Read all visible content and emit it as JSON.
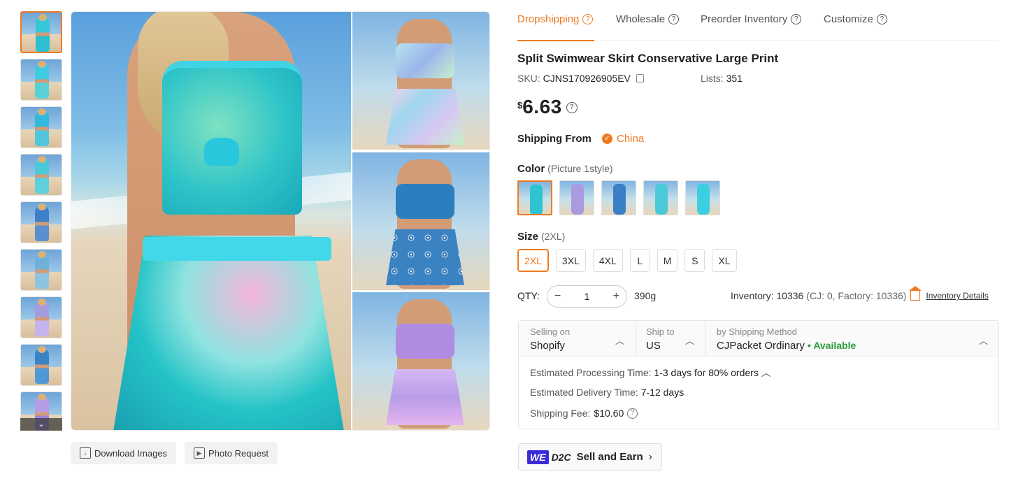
{
  "gallery": {
    "thumbnails": [
      {
        "top": "#36c7d6",
        "skirt": "#2bbfcf"
      },
      {
        "top": "#3ecae0",
        "skirt": "#5ad0d8"
      },
      {
        "top": "#34b9de",
        "skirt": "#4fc6dc"
      },
      {
        "top": "#4cc8d8",
        "skirt": "#5dd0dd"
      },
      {
        "top": "#3d7fc8",
        "skirt": "#5b8fd0"
      },
      {
        "top": "#6fb2d8",
        "skirt": "#8fc4e0"
      },
      {
        "top": "#a79be0",
        "skirt": "#c5b3ee"
      },
      {
        "top": "#3a83c4",
        "skirt": "#4f9ad4"
      },
      {
        "top": "#b69be6",
        "skirt": "#9c84dc"
      }
    ],
    "scroll_icon": "chevron-down-icon",
    "scroll_glyph": "⌄"
  },
  "actions": {
    "download_images": "Download Images",
    "photo_request": "Photo Request"
  },
  "tabs": {
    "dropshipping": "Dropshipping",
    "wholesale": "Wholesale",
    "preorder": "Preorder Inventory",
    "customize": "Customize",
    "help_glyph": "?"
  },
  "product": {
    "title": "Split Swimwear Skirt Conservative Large Print",
    "sku_label": "SKU:",
    "sku": "CJNS170926905EV",
    "lists_label": "Lists:",
    "lists": "351",
    "currency": "$",
    "price": "6.63"
  },
  "shipping_from": {
    "label": "Shipping From",
    "country": "China",
    "check_glyph": "✓"
  },
  "color": {
    "label": "Color",
    "selected": "(Picture 1style)",
    "options": [
      {
        "fg": "#2fc3cf"
      },
      {
        "fg": "#a99ae2"
      },
      {
        "fg": "#3b7fc6"
      },
      {
        "fg": "#4cc9d8"
      },
      {
        "fg": "#3ccfe2"
      }
    ]
  },
  "size": {
    "label": "Size",
    "selected": "(2XL)",
    "options": [
      "2XL",
      "3XL",
      "4XL",
      "L",
      "M",
      "S",
      "XL"
    ]
  },
  "quantity": {
    "label": "QTY:",
    "value": "1",
    "minus": "−",
    "plus": "+",
    "weight": "390g"
  },
  "inventory": {
    "label": "Inventory: 10336",
    "detail": "(CJ: 0, Factory: 10336)",
    "link": "Inventory Details"
  },
  "shipping": {
    "selling_on_label": "Selling on",
    "selling_on": "Shopify",
    "ship_to_label": "Ship to",
    "ship_to": "US",
    "method_label": "by Shipping Method",
    "method": "CJPacket Ordinary",
    "availability": "• Available",
    "chevron": "︿",
    "processing_label": "Estimated Processing Time:",
    "processing": "1-3 days for 80% orders",
    "delivery_label": "Estimated Delivery Time:",
    "delivery": "7-12 days",
    "fee_label": "Shipping Fee:",
    "fee": "$10.60"
  },
  "promo": {
    "we": "WE",
    "mark": "D2C",
    "label": "Sell and Earn",
    "arrow": "›"
  },
  "colors": {
    "accent": "#f07a22",
    "available": "#2c9c3a",
    "we_badge": "#3b2bd9"
  }
}
